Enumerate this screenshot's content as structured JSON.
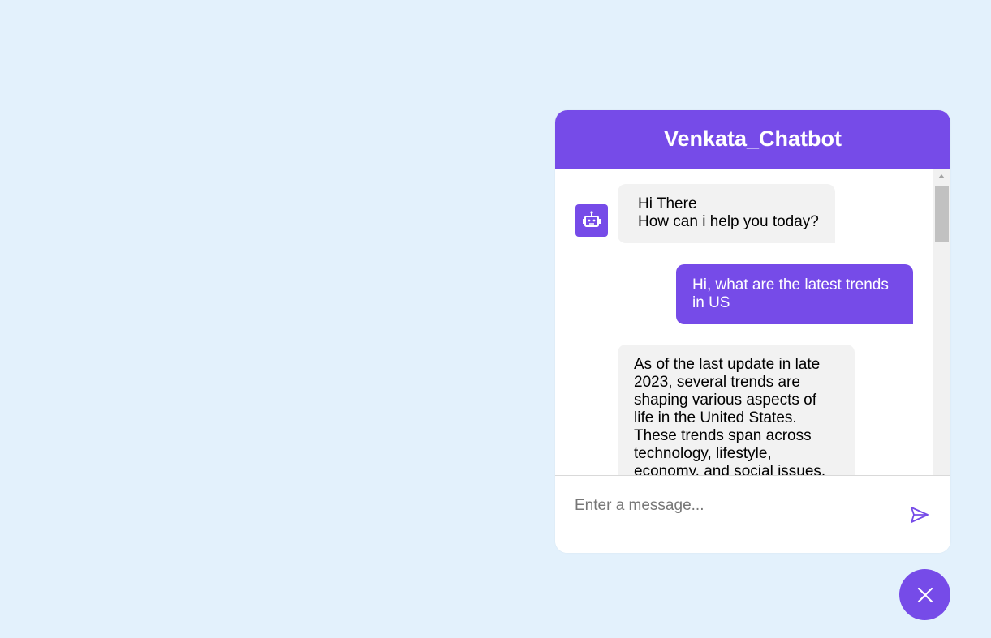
{
  "header": {
    "title": "Venkata_Chatbot"
  },
  "messages": [
    {
      "role": "bot",
      "lines": [
        "Hi There",
        "How can i help you today?"
      ]
    },
    {
      "role": "user",
      "lines": [
        "Hi, what are the latest trends",
        "in US"
      ]
    },
    {
      "role": "bot",
      "lines": [
        "As of the last update in late",
        "2023, several trends are",
        "shaping various aspects of",
        "life in the United States.",
        "These trends span across",
        "technology, lifestyle,",
        "economy, and social issues."
      ]
    }
  ],
  "composer": {
    "placeholder": "Enter a message..."
  },
  "icons": {
    "avatar": "robot-icon",
    "send": "send-icon",
    "toggle": "close-icon"
  },
  "colors": {
    "accent": "#764be8",
    "background": "#e3f1fc",
    "bot_bubble": "#f2f2f2"
  }
}
